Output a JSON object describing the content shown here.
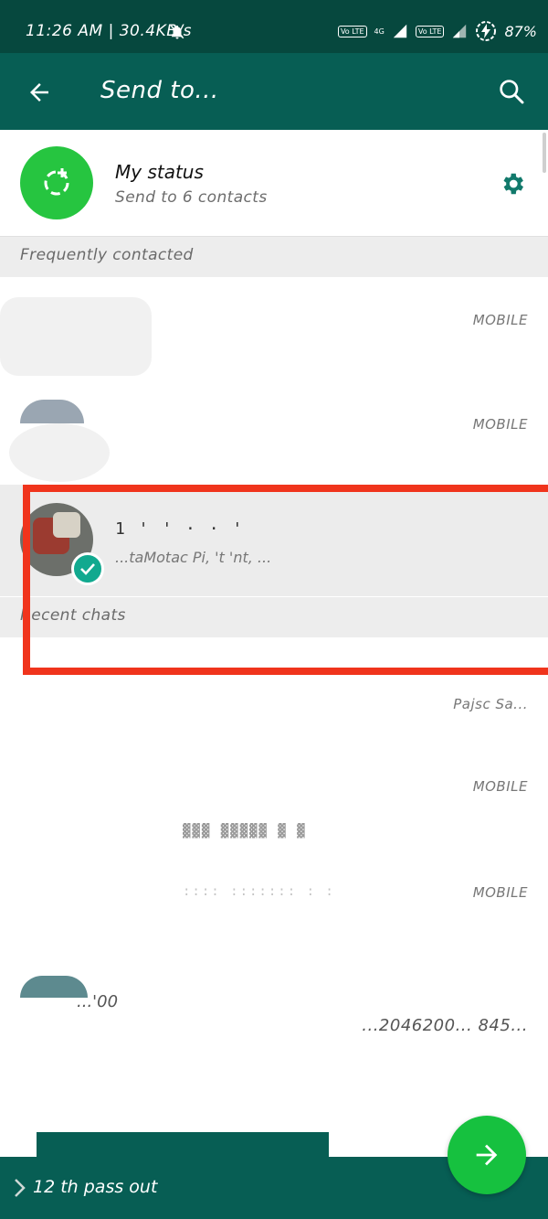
{
  "status_bar": {
    "time": "11:26 AM | 30.4KB/s",
    "volte_1": "Vo LTE",
    "network_4g": "4G",
    "volte_2": "Vo LTE",
    "battery": "87%"
  },
  "app_bar": {
    "title": "Send to..."
  },
  "my_status": {
    "name": "My status",
    "subtitle": "Send to 6 contacts"
  },
  "sections": {
    "frequently_contacted": "Frequently contacted",
    "recent_chats": "Recent chats"
  },
  "contacts": {
    "frequent_1_label": "MOBILE",
    "frequent_2_label": "MOBILE",
    "selected_subtitle": "...taMotac Pi, 't 'nt, ...",
    "recent_1_label": "Pajsc Sa...",
    "recent_2_label": "MOBILE",
    "recent_3_label": "MOBILE",
    "recent_4_name": "...'00",
    "recent_4_label": "...2046200... 845..."
  },
  "bottom_bar": {
    "text": "12 th pass out"
  },
  "colors": {
    "status_bar": "#06483e",
    "app_bar": "#075e54",
    "accent_green": "#26c540",
    "check_teal": "#11a98f",
    "highlight_red": "#f0341c"
  }
}
